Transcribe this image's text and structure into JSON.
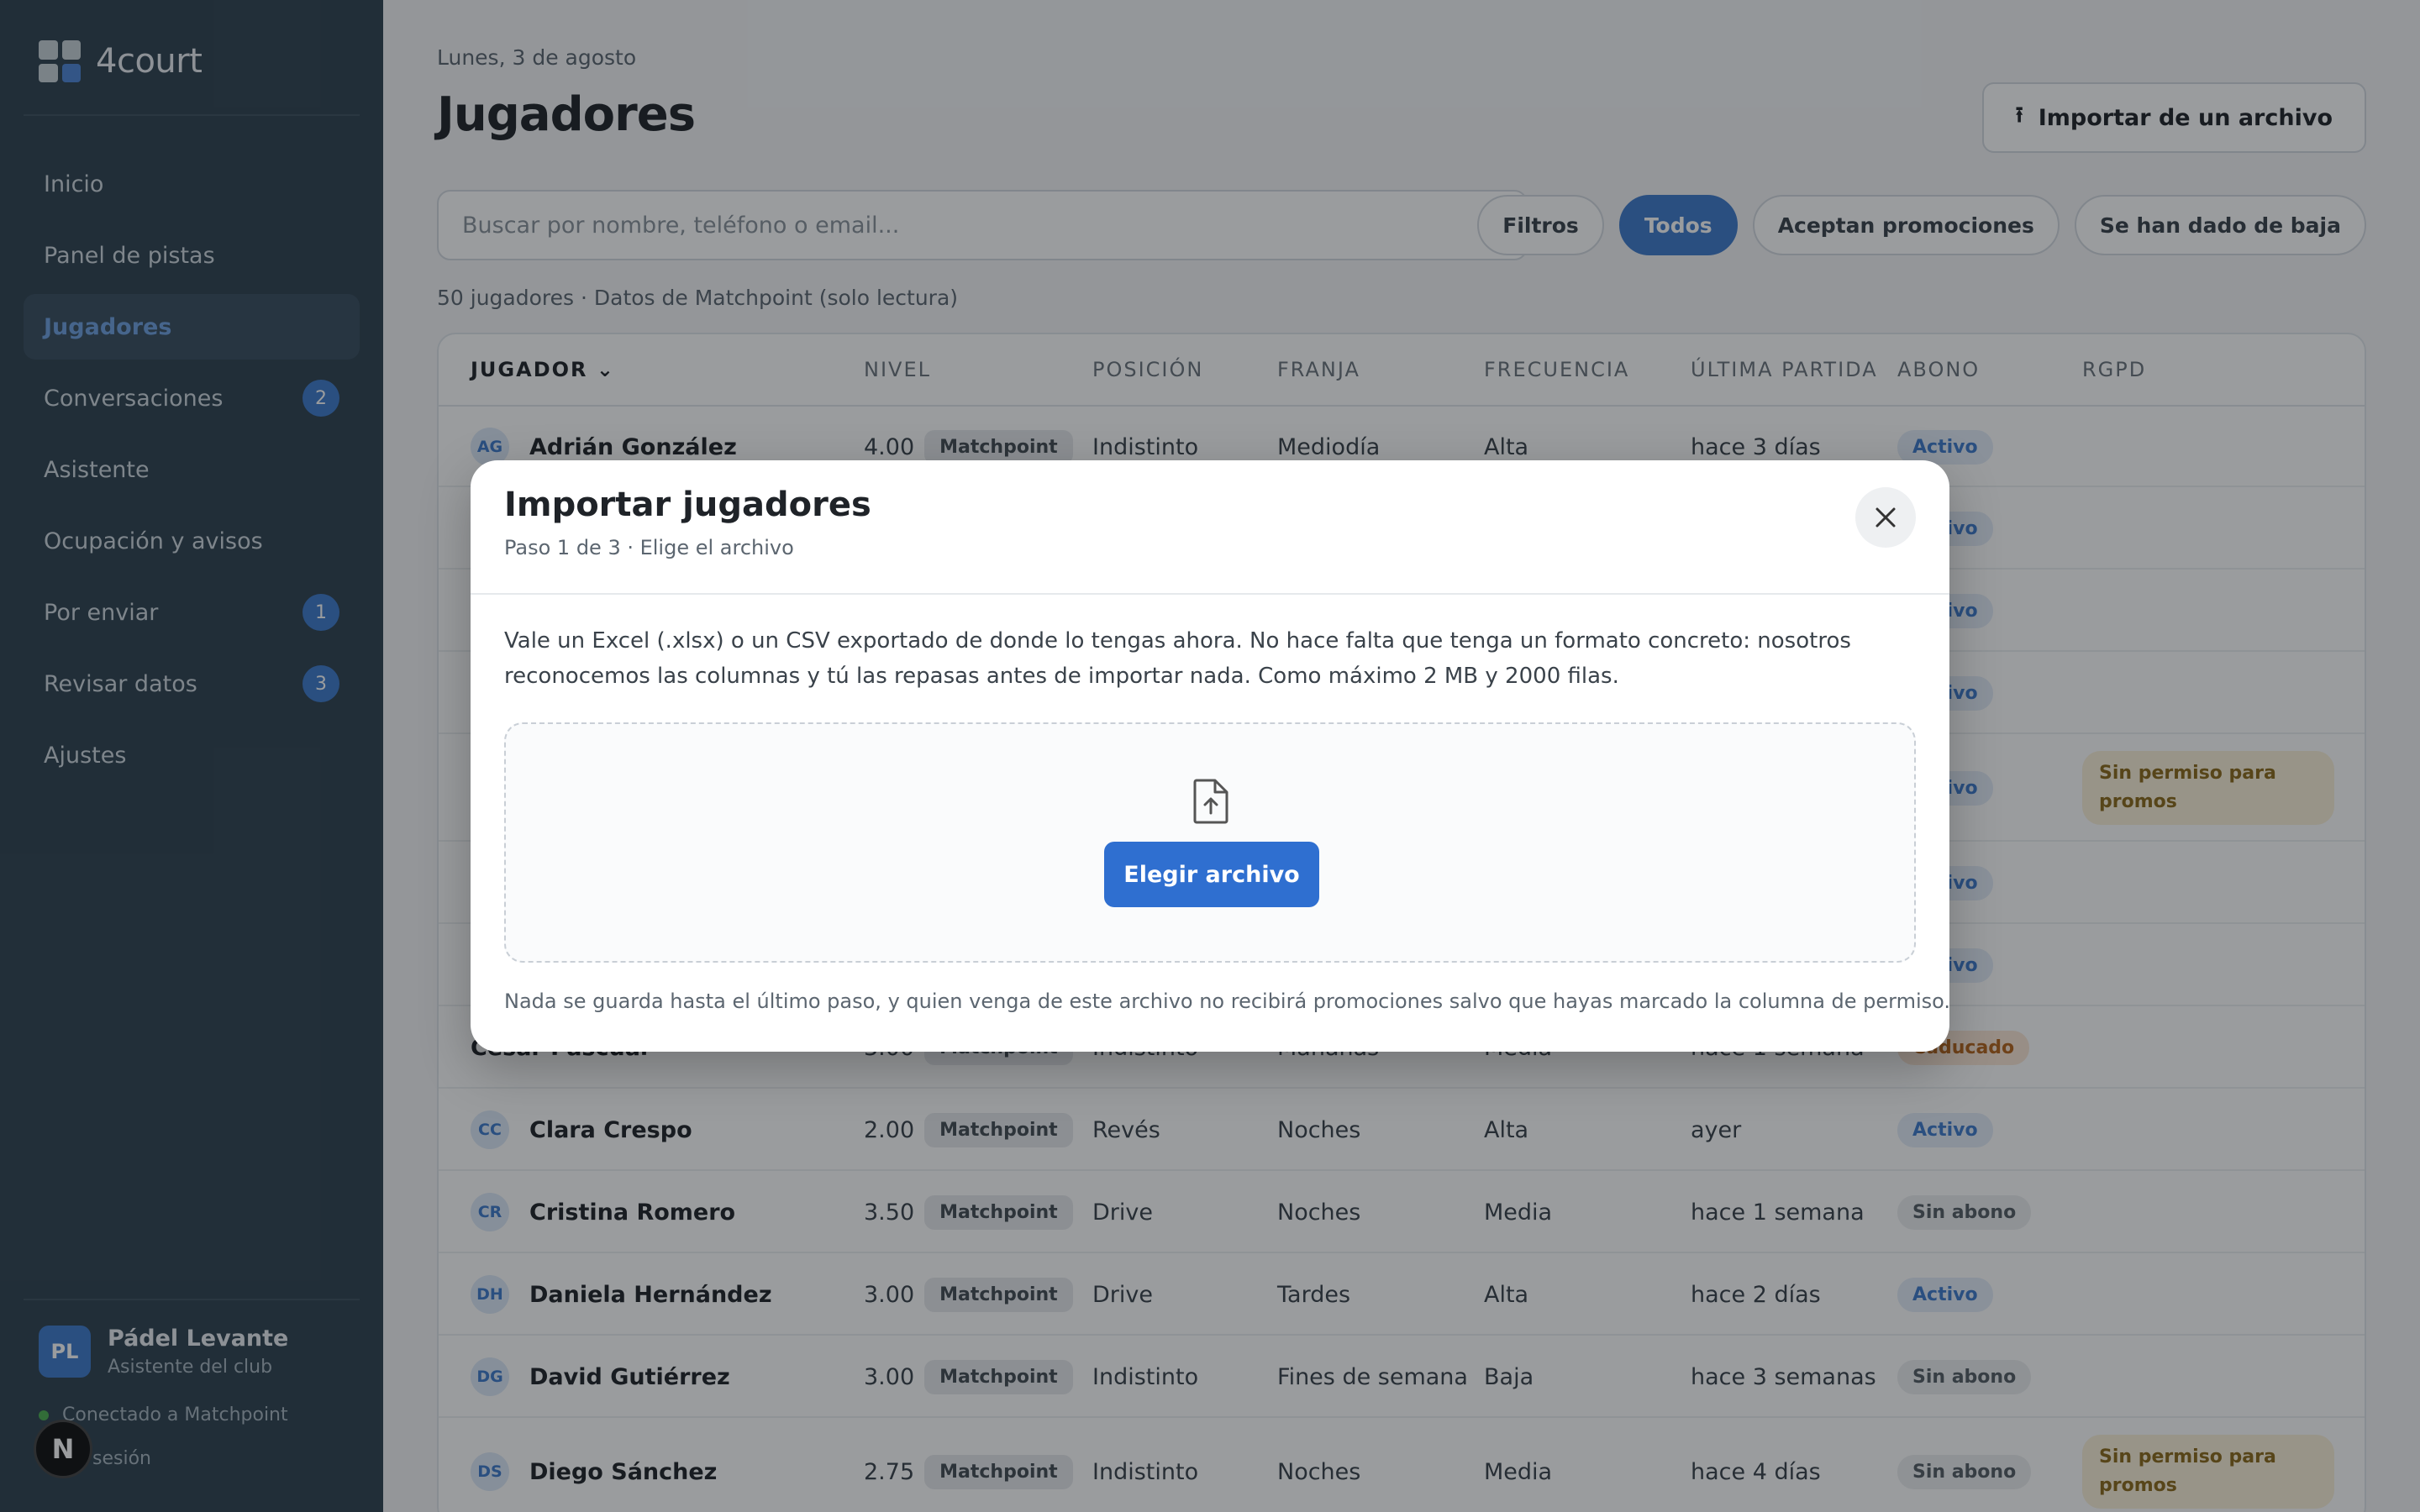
{
  "sidebar": {
    "brand": "4court",
    "nav": [
      {
        "label": "Inicio",
        "badge": ""
      },
      {
        "label": "Panel de pistas",
        "badge": ""
      },
      {
        "label": "Jugadores",
        "badge": ""
      },
      {
        "label": "Conversaciones",
        "badge": "2"
      },
      {
        "label": "Asistente",
        "badge": ""
      },
      {
        "label": "Ocupación y avisos",
        "badge": ""
      },
      {
        "label": "Por enviar",
        "badge": "1"
      },
      {
        "label": "Revisar datos",
        "badge": "3"
      },
      {
        "label": "Ajustes",
        "badge": ""
      }
    ],
    "active_item": "Jugadores",
    "club": {
      "initials": "PL",
      "name": "Pádel Levante",
      "subtitle": "Asistente del club"
    },
    "connection": "Conectado a Matchpoint",
    "logout": "sesión",
    "n_badge": "N"
  },
  "header": {
    "date": "Lunes, 3 de agosto",
    "title": "Jugadores",
    "import_button": "Importar de un archivo",
    "search_placeholder": "Buscar por nombre, teléfono o email...",
    "filters": [
      "Filtros",
      "Todos",
      "Aceptan promociones",
      "Se han dado de baja"
    ],
    "active_filter": "Todos",
    "count": "50 jugadores · Datos de Matchpoint (solo lectura)"
  },
  "table": {
    "columns": [
      "JUGADOR",
      "NIVEL",
      "POSICIÓN",
      "FRANJA",
      "FRECUENCIA",
      "ÚLTIMA PARTIDA",
      "ABONO",
      "RGPD"
    ],
    "source_tag": "Matchpoint",
    "rows": [
      {
        "initials": "AG",
        "name": "Adrián González",
        "level": "4.00",
        "position": "Indistinto",
        "slot": "Mediodía",
        "frequency": "Alta",
        "last": "hace 3 días",
        "abono": "Activo",
        "abono_type": "activo",
        "rgpd": ""
      },
      {
        "initials": "",
        "name": "",
        "level": "",
        "position": "",
        "slot": "",
        "frequency": "",
        "last": "",
        "abono": "Activo",
        "abono_type": "activo",
        "rgpd": ""
      },
      {
        "initials": "",
        "name": "",
        "level": "",
        "position": "",
        "slot": "",
        "frequency": "",
        "last": "",
        "abono": "Activo",
        "abono_type": "activo",
        "rgpd": ""
      },
      {
        "initials": "",
        "name": "",
        "level": "",
        "position": "",
        "slot": "",
        "frequency": "",
        "last": "",
        "abono": "Activo",
        "abono_type": "activo",
        "rgpd": ""
      },
      {
        "initials": "",
        "name": "",
        "level": "",
        "position": "",
        "slot": "",
        "frequency": "",
        "last": "",
        "abono": "Activo",
        "abono_type": "activo",
        "rgpd": "Sin permiso para promos"
      },
      {
        "initials": "",
        "name": "",
        "level": "",
        "position": "",
        "slot": "",
        "frequency": "",
        "last": "",
        "abono": "Activo",
        "abono_type": "activo",
        "rgpd": ""
      },
      {
        "initials": "",
        "name": "",
        "level": "",
        "position": "",
        "slot": "",
        "frequency": "",
        "last": "",
        "abono": "Activo",
        "abono_type": "activo",
        "rgpd": ""
      },
      {
        "initials": "",
        "name": "César Pascual",
        "level": "3.00",
        "position": "Indistinto",
        "slot": "Mañanas",
        "frequency": "Media",
        "last": "hace 1 semana",
        "abono": "Caducado",
        "abono_type": "caducado",
        "rgpd": ""
      },
      {
        "initials": "CC",
        "name": "Clara Crespo",
        "level": "2.00",
        "position": "Revés",
        "slot": "Noches",
        "frequency": "Alta",
        "last": "ayer",
        "abono": "Activo",
        "abono_type": "activo",
        "rgpd": ""
      },
      {
        "initials": "CR",
        "name": "Cristina Romero",
        "level": "3.50",
        "position": "Drive",
        "slot": "Noches",
        "frequency": "Media",
        "last": "hace 1 semana",
        "abono": "Sin abono",
        "abono_type": "sinabono",
        "rgpd": ""
      },
      {
        "initials": "DH",
        "name": "Daniela Hernández",
        "level": "3.00",
        "position": "Drive",
        "slot": "Tardes",
        "frequency": "Alta",
        "last": "hace 2 días",
        "abono": "Activo",
        "abono_type": "activo",
        "rgpd": ""
      },
      {
        "initials": "DG",
        "name": "David Gutiérrez",
        "level": "3.00",
        "position": "Indistinto",
        "slot": "Fines de semana",
        "frequency": "Baja",
        "last": "hace 3 semanas",
        "abono": "Sin abono",
        "abono_type": "sinabono",
        "rgpd": ""
      },
      {
        "initials": "DS",
        "name": "Diego Sánchez",
        "level": "2.75",
        "position": "Indistinto",
        "slot": "Noches",
        "frequency": "Media",
        "last": "hace 4 días",
        "abono": "Sin abono",
        "abono_type": "sinabono",
        "rgpd": "Sin permiso para promos"
      }
    ]
  },
  "modal": {
    "title": "Importar jugadores",
    "subtitle": "Paso 1 de 3 · Elige el archivo",
    "close_icon": "close-icon",
    "description": "Vale un Excel (.xlsx) o un CSV exportado de donde lo tengas ahora. No hace falta que tenga un formato concreto: nosotros reconocemos las columnas y tú las repasas antes de importar nada. Como máximo 2 MB y 2000 filas.",
    "file_icon": "file-upload-icon",
    "choose_button": "Elegir archivo",
    "note": "Nada se guarda hasta el último paso, y quien venga de este archivo no recibirá promociones salvo que hayas marcado la columna de permiso."
  },
  "colors": {
    "accent": "#3f7acb",
    "sidebar": "#2f4250",
    "button": "#2f6fd0"
  }
}
